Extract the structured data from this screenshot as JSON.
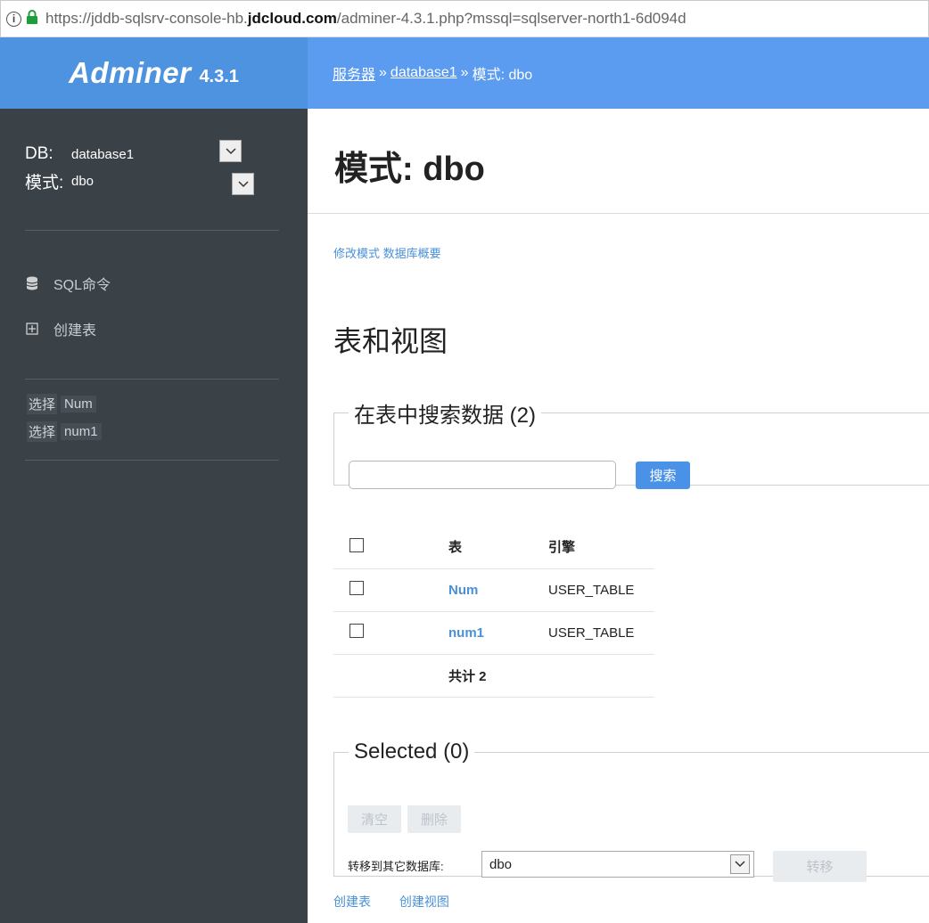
{
  "browser": {
    "url_prefix": "https://jddb-sqlsrv-console-hb.",
    "url_domain": "jdcloud.com",
    "url_suffix": "/adminer-4.3.1.php?mssql=sqlserver-north1-6d094d"
  },
  "logo": {
    "name": "Adminer",
    "version": "4.3.1"
  },
  "sidebar": {
    "db_label": "DB:",
    "db_value": "database1",
    "schema_label": "模式:",
    "schema_value": "dbo",
    "nav": [
      {
        "label": "SQL命令",
        "icon": "database-icon"
      },
      {
        "label": "创建表",
        "icon": "table-plus-icon"
      }
    ],
    "tables": [
      {
        "select": "选择",
        "name": "Num"
      },
      {
        "select": "选择",
        "name": "num1"
      }
    ]
  },
  "breadcrumb": {
    "server": "服务器",
    "sep": "»",
    "db": "database1",
    "current": "模式: dbo"
  },
  "page_title": "模式: dbo",
  "top_links": {
    "alter_schema": "修改模式",
    "db_overview": "数据库概要"
  },
  "section_title": "表和视图",
  "search": {
    "legend": "在表中搜索数据 (2)",
    "value": "",
    "button": "搜索"
  },
  "table": {
    "headers": {
      "name": "表",
      "engine": "引擎"
    },
    "rows": [
      {
        "name": "Num",
        "engine": "USER_TABLE"
      },
      {
        "name": "num1",
        "engine": "USER_TABLE"
      }
    ],
    "total": "共计 2"
  },
  "selected": {
    "legend": "Selected (0)",
    "truncate": "清空",
    "drop": "删除",
    "move_label": "转移到其它数据库:",
    "move_value": "dbo",
    "move_button": "转移"
  },
  "bottom_links": {
    "create_table": "创建表",
    "create_view": "创建视图"
  },
  "colors": {
    "logo_bg": "#4d93e0",
    "crumb_bg": "#5b9bf0",
    "sidebar_bg": "#3a4147",
    "link": "#4a90d9"
  }
}
